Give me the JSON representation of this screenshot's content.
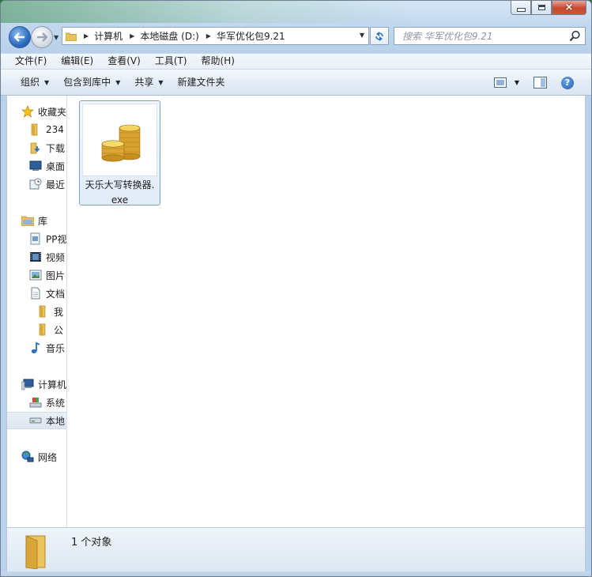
{
  "window": {
    "close_glyph": "×"
  },
  "address": {
    "crumbs": [
      "计算机",
      "本地磁盘 (D:)",
      "华军优化包9.21"
    ]
  },
  "search": {
    "placeholder": "搜索 华军优化包9.21"
  },
  "menu": [
    "文件(F)",
    "编辑(E)",
    "查看(V)",
    "工具(T)",
    "帮助(H)"
  ],
  "toolbar": {
    "organize": "组织",
    "include_library": "包含到库中",
    "share": "共享",
    "new_folder": "新建文件夹",
    "help": "?"
  },
  "navpane": {
    "favorites": "收藏夹",
    "fav_items": [
      "234",
      "下载",
      "桌面",
      "最近"
    ],
    "libraries": "库",
    "lib_items": [
      "PP视",
      "视频",
      "图片",
      "文档",
      "我",
      "公",
      "音乐"
    ],
    "computer": "计算机",
    "comp_items": [
      "系统",
      "本地"
    ],
    "network": "网络"
  },
  "files": [
    {
      "name_line1": "天乐大写转换器.",
      "name_line2": "exe"
    }
  ],
  "status": {
    "count": "1 个对象"
  },
  "colors": {
    "accent": "#2c6cc0",
    "selection": "#e1ecf8"
  }
}
